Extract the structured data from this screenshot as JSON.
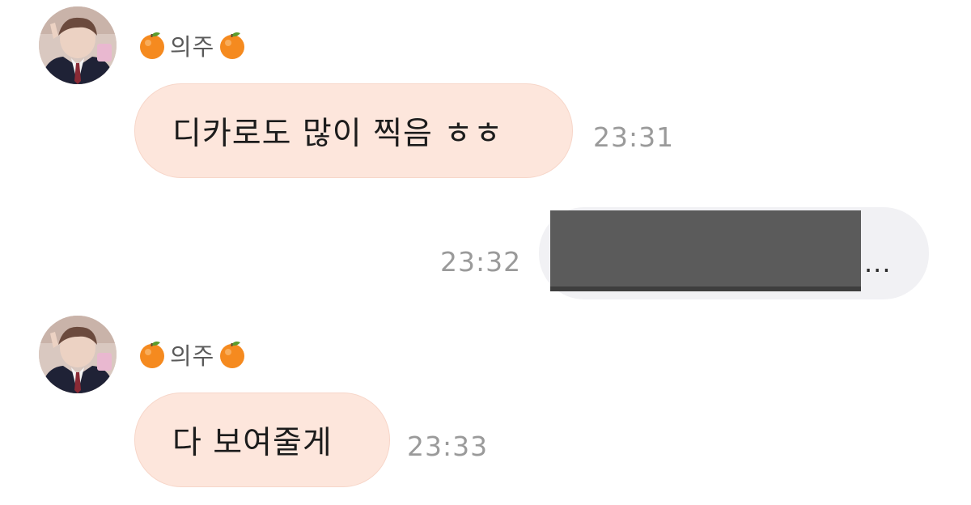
{
  "messages": [
    {
      "sender": "의주",
      "avatar_icon": "profile-photo",
      "sender_icon": "tangerine-emoji",
      "text": "디카로도 많이 찍음 ㅎㅎ",
      "time": "23:31"
    },
    {
      "direction": "outgoing",
      "time": "23:32",
      "more_label": "..."
    },
    {
      "sender": "의주",
      "avatar_icon": "profile-photo",
      "sender_icon": "tangerine-emoji",
      "text": "다 보여줄게",
      "time": "23:33"
    }
  ],
  "colors": {
    "incoming_bubble": "#fde6dc",
    "outgoing_bubble": "#f1f1f4",
    "redacted": "#5b5b5b",
    "time_text": "#9a9a9a"
  }
}
